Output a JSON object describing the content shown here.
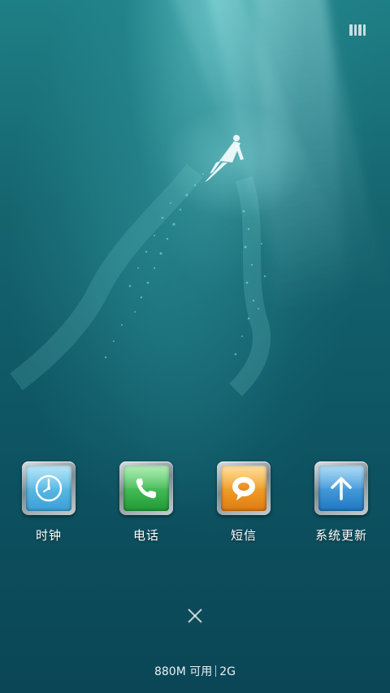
{
  "status_bar": {
    "icon": "battery-icon"
  },
  "wallpaper": {
    "icon": "swimmer-underwater-illustration"
  },
  "dock": {
    "apps": [
      {
        "label": "时钟",
        "icon": "clock-icon",
        "color": "#3aa0d6"
      },
      {
        "label": "电话",
        "icon": "phone-icon",
        "color": "#1f9a36"
      },
      {
        "label": "短信",
        "icon": "message-bubble-icon",
        "color": "#e07b0c"
      },
      {
        "label": "系统更新",
        "icon": "up-arrow-icon",
        "color": "#1f78c2"
      }
    ]
  },
  "recent_panel": {
    "close_icon": "close-icon",
    "memory_available": "880M 可用",
    "memory_total": "2G"
  }
}
